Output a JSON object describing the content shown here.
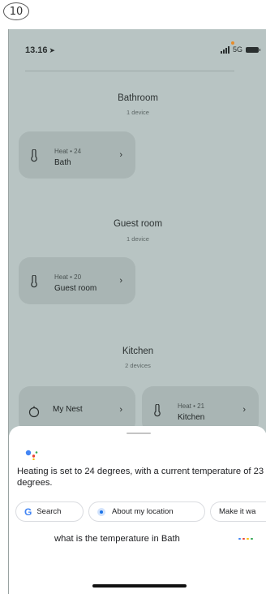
{
  "step_number": "10",
  "status_bar": {
    "time": "13.16",
    "network": "5G"
  },
  "rooms": [
    {
      "name": "Bathroom",
      "count": "1 device",
      "tiles": [
        {
          "icon": "thermometer-icon",
          "status": "Heat • 24",
          "name": "Bath"
        }
      ]
    },
    {
      "name": "Guest room",
      "count": "1 device",
      "tiles": [
        {
          "icon": "thermometer-icon",
          "status": "Heat • 20",
          "name": "Guest room"
        }
      ]
    },
    {
      "name": "Kitchen",
      "count": "2 devices",
      "tiles": [
        {
          "icon": "thermostat-dial-icon",
          "status": "",
          "name": "My Nest"
        },
        {
          "icon": "thermometer-icon",
          "status": "Heat • 21",
          "name": "Kitchen"
        }
      ]
    }
  ],
  "assistant": {
    "reply": "Heating is set to 24 degrees, with a current temperature of 23 degrees.",
    "chips": [
      {
        "icon": "google-g-icon",
        "label": "Search"
      },
      {
        "icon": "location-icon",
        "label": "About my location"
      },
      {
        "icon": "",
        "label": "Make it wa"
      }
    ],
    "query": "what is the temperature in Bath"
  },
  "colors": {
    "backdrop": "#b8c4c3",
    "tile": "#a9b5b4",
    "google_blue": "#4285f4",
    "google_red": "#ea4335",
    "google_yellow": "#fbbc05",
    "google_green": "#34a853"
  }
}
